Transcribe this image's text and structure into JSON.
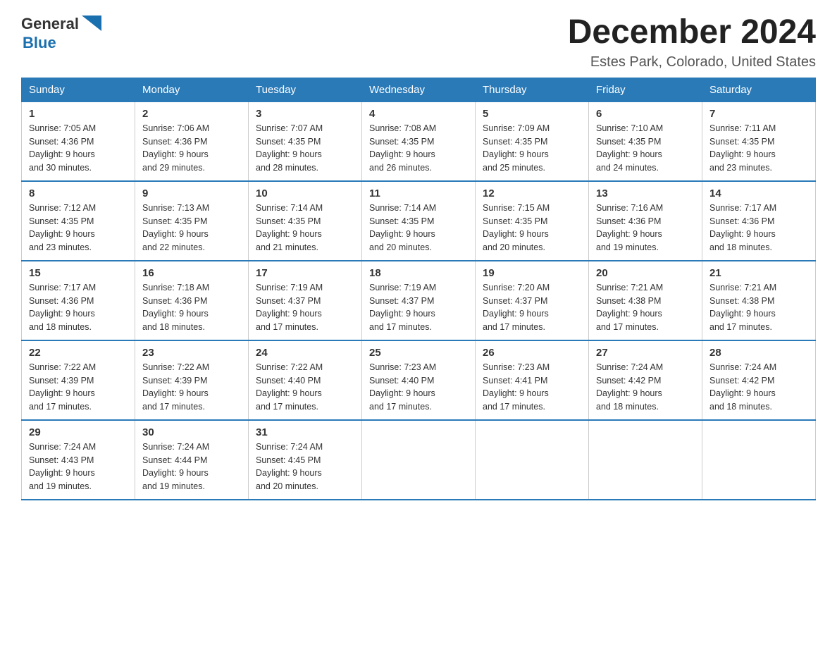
{
  "header": {
    "logo": {
      "general": "General",
      "blue": "Blue"
    },
    "title": "December 2024",
    "subtitle": "Estes Park, Colorado, United States"
  },
  "days_of_week": [
    "Sunday",
    "Monday",
    "Tuesday",
    "Wednesday",
    "Thursday",
    "Friday",
    "Saturday"
  ],
  "weeks": [
    [
      {
        "day": "1",
        "sunrise": "7:05 AM",
        "sunset": "4:36 PM",
        "daylight": "9 hours and 30 minutes."
      },
      {
        "day": "2",
        "sunrise": "7:06 AM",
        "sunset": "4:36 PM",
        "daylight": "9 hours and 29 minutes."
      },
      {
        "day": "3",
        "sunrise": "7:07 AM",
        "sunset": "4:35 PM",
        "daylight": "9 hours and 28 minutes."
      },
      {
        "day": "4",
        "sunrise": "7:08 AM",
        "sunset": "4:35 PM",
        "daylight": "9 hours and 26 minutes."
      },
      {
        "day": "5",
        "sunrise": "7:09 AM",
        "sunset": "4:35 PM",
        "daylight": "9 hours and 25 minutes."
      },
      {
        "day": "6",
        "sunrise": "7:10 AM",
        "sunset": "4:35 PM",
        "daylight": "9 hours and 24 minutes."
      },
      {
        "day": "7",
        "sunrise": "7:11 AM",
        "sunset": "4:35 PM",
        "daylight": "9 hours and 23 minutes."
      }
    ],
    [
      {
        "day": "8",
        "sunrise": "7:12 AM",
        "sunset": "4:35 PM",
        "daylight": "9 hours and 23 minutes."
      },
      {
        "day": "9",
        "sunrise": "7:13 AM",
        "sunset": "4:35 PM",
        "daylight": "9 hours and 22 minutes."
      },
      {
        "day": "10",
        "sunrise": "7:14 AM",
        "sunset": "4:35 PM",
        "daylight": "9 hours and 21 minutes."
      },
      {
        "day": "11",
        "sunrise": "7:14 AM",
        "sunset": "4:35 PM",
        "daylight": "9 hours and 20 minutes."
      },
      {
        "day": "12",
        "sunrise": "7:15 AM",
        "sunset": "4:35 PM",
        "daylight": "9 hours and 20 minutes."
      },
      {
        "day": "13",
        "sunrise": "7:16 AM",
        "sunset": "4:36 PM",
        "daylight": "9 hours and 19 minutes."
      },
      {
        "day": "14",
        "sunrise": "7:17 AM",
        "sunset": "4:36 PM",
        "daylight": "9 hours and 18 minutes."
      }
    ],
    [
      {
        "day": "15",
        "sunrise": "7:17 AM",
        "sunset": "4:36 PM",
        "daylight": "9 hours and 18 minutes."
      },
      {
        "day": "16",
        "sunrise": "7:18 AM",
        "sunset": "4:36 PM",
        "daylight": "9 hours and 18 minutes."
      },
      {
        "day": "17",
        "sunrise": "7:19 AM",
        "sunset": "4:37 PM",
        "daylight": "9 hours and 17 minutes."
      },
      {
        "day": "18",
        "sunrise": "7:19 AM",
        "sunset": "4:37 PM",
        "daylight": "9 hours and 17 minutes."
      },
      {
        "day": "19",
        "sunrise": "7:20 AM",
        "sunset": "4:37 PM",
        "daylight": "9 hours and 17 minutes."
      },
      {
        "day": "20",
        "sunrise": "7:21 AM",
        "sunset": "4:38 PM",
        "daylight": "9 hours and 17 minutes."
      },
      {
        "day": "21",
        "sunrise": "7:21 AM",
        "sunset": "4:38 PM",
        "daylight": "9 hours and 17 minutes."
      }
    ],
    [
      {
        "day": "22",
        "sunrise": "7:22 AM",
        "sunset": "4:39 PM",
        "daylight": "9 hours and 17 minutes."
      },
      {
        "day": "23",
        "sunrise": "7:22 AM",
        "sunset": "4:39 PM",
        "daylight": "9 hours and 17 minutes."
      },
      {
        "day": "24",
        "sunrise": "7:22 AM",
        "sunset": "4:40 PM",
        "daylight": "9 hours and 17 minutes."
      },
      {
        "day": "25",
        "sunrise": "7:23 AM",
        "sunset": "4:40 PM",
        "daylight": "9 hours and 17 minutes."
      },
      {
        "day": "26",
        "sunrise": "7:23 AM",
        "sunset": "4:41 PM",
        "daylight": "9 hours and 17 minutes."
      },
      {
        "day": "27",
        "sunrise": "7:24 AM",
        "sunset": "4:42 PM",
        "daylight": "9 hours and 18 minutes."
      },
      {
        "day": "28",
        "sunrise": "7:24 AM",
        "sunset": "4:42 PM",
        "daylight": "9 hours and 18 minutes."
      }
    ],
    [
      {
        "day": "29",
        "sunrise": "7:24 AM",
        "sunset": "4:43 PM",
        "daylight": "9 hours and 19 minutes."
      },
      {
        "day": "30",
        "sunrise": "7:24 AM",
        "sunset": "4:44 PM",
        "daylight": "9 hours and 19 minutes."
      },
      {
        "day": "31",
        "sunrise": "7:24 AM",
        "sunset": "4:45 PM",
        "daylight": "9 hours and 20 minutes."
      },
      null,
      null,
      null,
      null
    ]
  ],
  "labels": {
    "sunrise": "Sunrise:",
    "sunset": "Sunset:",
    "daylight": "Daylight:"
  }
}
